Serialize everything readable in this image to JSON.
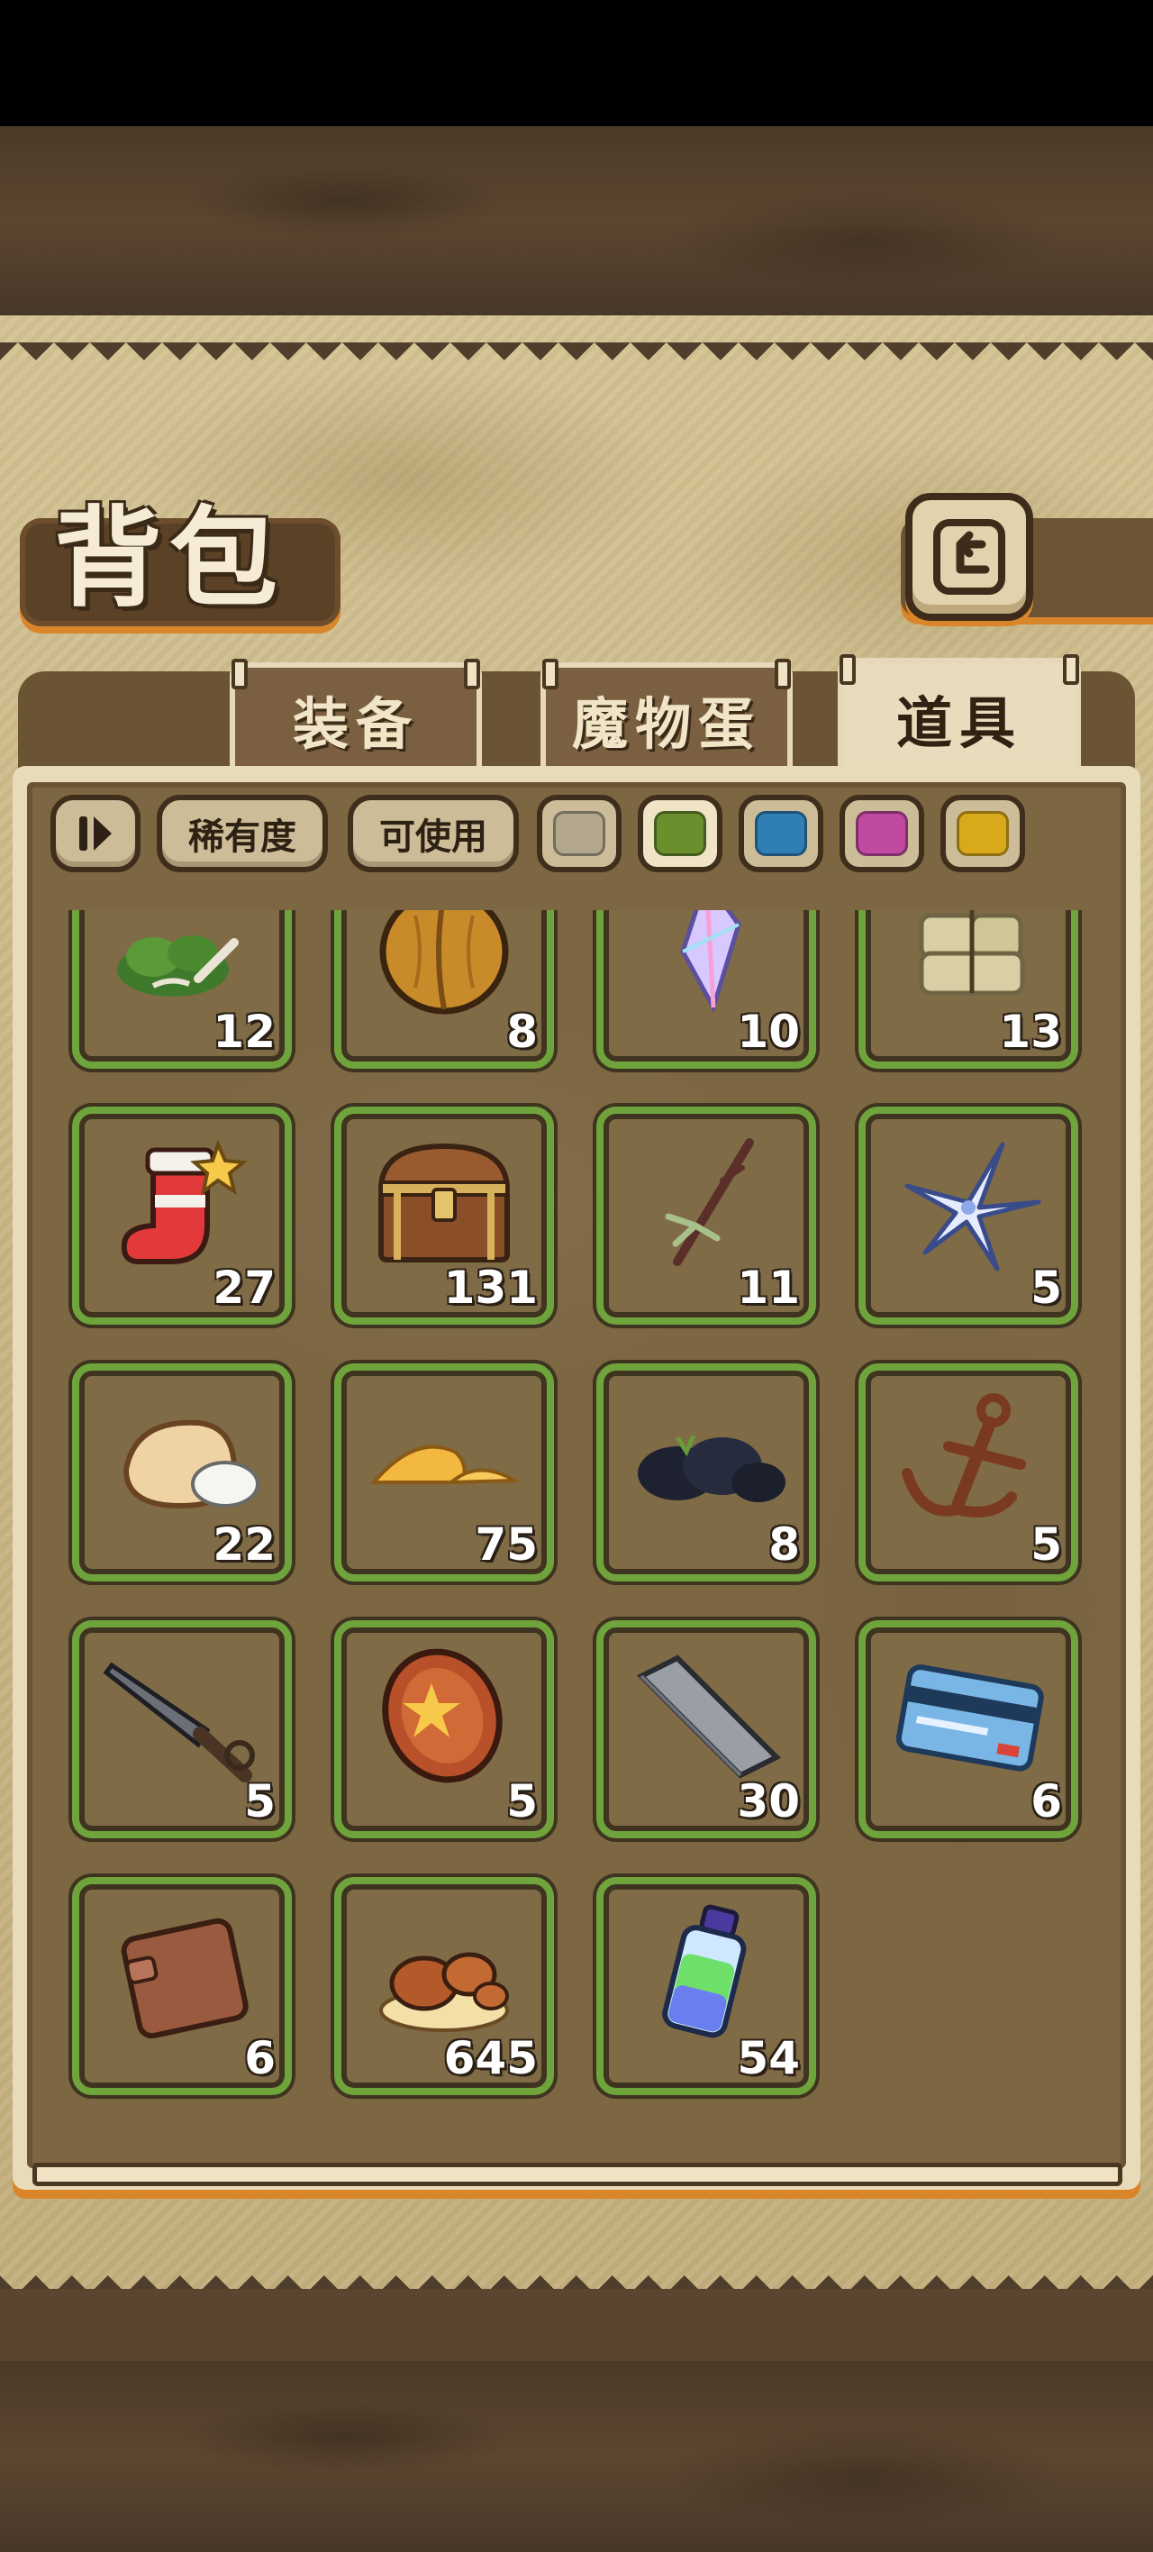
{
  "header": {
    "title": "背包"
  },
  "tabs": [
    {
      "label": "装备",
      "active": false
    },
    {
      "label": "魔物蛋",
      "active": false
    },
    {
      "label": "道具",
      "active": true
    }
  ],
  "filters": {
    "sort_icon": "sort-toggle-icon",
    "rarity_label": "稀有度",
    "usable_label": "可使用",
    "swatches": [
      {
        "name": "gray",
        "color": "#b3a88e",
        "selected": false
      },
      {
        "name": "green",
        "color": "#6b8f2c",
        "selected": true
      },
      {
        "name": "blue",
        "color": "#2f7fb5",
        "selected": false
      },
      {
        "name": "purple",
        "color": "#c04aa0",
        "selected": false
      },
      {
        "name": "yellow",
        "color": "#d9a91c",
        "selected": false
      }
    ]
  },
  "items": [
    {
      "icon": "herb-bundle-icon",
      "count": "12"
    },
    {
      "icon": "walnut-icon",
      "count": "8"
    },
    {
      "icon": "crystal-shard-icon",
      "count": "10"
    },
    {
      "icon": "hay-bale-icon",
      "count": "13"
    },
    {
      "icon": "christmas-stocking-icon",
      "count": "27"
    },
    {
      "icon": "treasure-chest-icon",
      "count": "131"
    },
    {
      "icon": "branch-with-bow-icon",
      "count": "11"
    },
    {
      "icon": "blue-flower-icon",
      "count": "5"
    },
    {
      "icon": "flour-sack-icon",
      "count": "22"
    },
    {
      "icon": "golden-sand-icon",
      "count": "75"
    },
    {
      "icon": "black-coal-icon",
      "count": "8"
    },
    {
      "icon": "anchor-icon",
      "count": "5"
    },
    {
      "icon": "knife-icon",
      "count": "5"
    },
    {
      "icon": "star-coin-icon",
      "count": "5"
    },
    {
      "icon": "iron-bar-icon",
      "count": "30"
    },
    {
      "icon": "bank-card-icon",
      "count": "6"
    },
    {
      "icon": "wallet-icon",
      "count": "6"
    },
    {
      "icon": "mushroom-cluster-icon",
      "count": "645"
    },
    {
      "icon": "potion-bottle-icon",
      "count": "54"
    }
  ]
}
